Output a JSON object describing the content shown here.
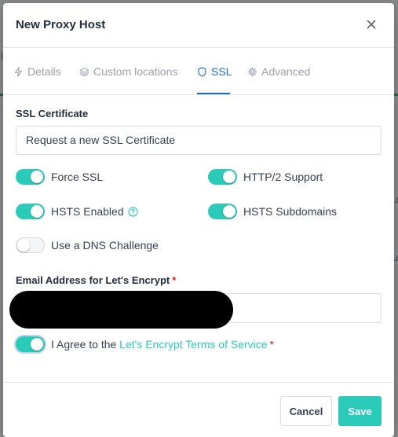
{
  "modal": {
    "title": "New Proxy Host"
  },
  "tabs": [
    {
      "label": "Details",
      "icon": "lightning-icon",
      "active": false
    },
    {
      "label": "Custom locations",
      "icon": "layers-icon",
      "active": false
    },
    {
      "label": "SSL",
      "icon": "shield-icon",
      "active": true
    },
    {
      "label": "Advanced",
      "icon": "gear-icon",
      "active": false
    }
  ],
  "ssl": {
    "certificate_label": "SSL Certificate",
    "certificate_value": "Request a new SSL Certificate",
    "toggles": {
      "force_ssl": {
        "label": "Force SSL",
        "on": true
      },
      "http2": {
        "label": "HTTP/2 Support",
        "on": true
      },
      "hsts_enabled": {
        "label": "HSTS Enabled",
        "on": true
      },
      "hsts_subdomains": {
        "label": "HSTS Subdomains",
        "on": true
      },
      "dns_challenge": {
        "label": "Use a DNS Challenge",
        "on": false
      }
    },
    "email_label": "Email Address for Let's Encrypt",
    "required_mark": "*",
    "agree_prefix": "I Agree to the ",
    "agree_link": "Let's Encrypt Terms of Service",
    "agree_on": true
  },
  "footer": {
    "cancel_label": "Cancel",
    "save_label": "Save"
  },
  "background": {
    "fragment_1": "l",
    "fragment_2": "u",
    "fragment_3": "u"
  },
  "colors": {
    "accent_teal": "#2bcbba",
    "tab_active_blue": "#206bc4",
    "required_red": "#cd201f"
  }
}
